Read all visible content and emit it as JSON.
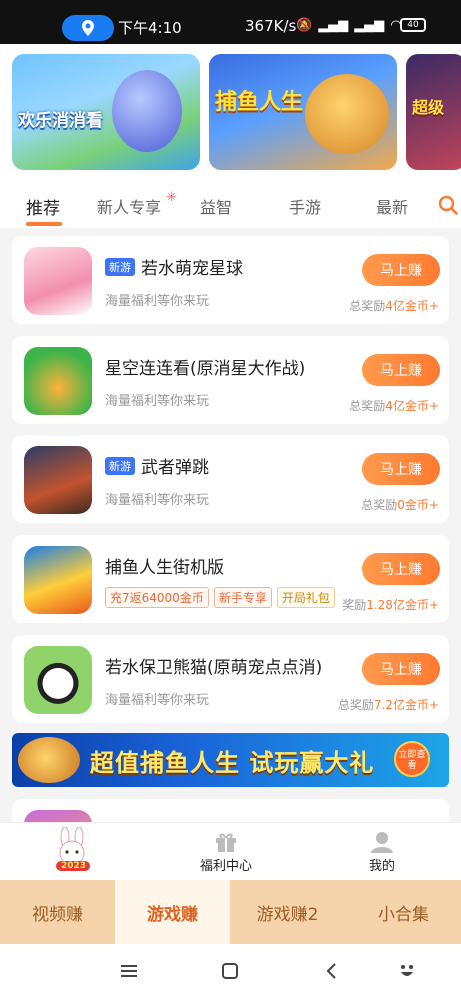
{
  "status_bar": {
    "time": "下午4:10",
    "speed": "367K/s",
    "battery": "40"
  },
  "banners": [
    {
      "title": "欢乐消消看"
    },
    {
      "title": "捕鱼人生"
    },
    {
      "title": "超级"
    }
  ],
  "tabs": [
    {
      "label": "推荐"
    },
    {
      "label": "新人专享"
    },
    {
      "label": "益智"
    },
    {
      "label": "手游"
    },
    {
      "label": "最新"
    }
  ],
  "games": [
    {
      "badge": "新游",
      "name": "若水萌宠星球",
      "subtitle": "海量福利等你来玩",
      "button": "马上赚",
      "reward_prefix": "总奖励",
      "reward_amount": "4亿金币+"
    },
    {
      "badge": "",
      "name": "星空连连看(原消星大作战)",
      "subtitle": "海量福利等你来玩",
      "button": "马上赚",
      "reward_prefix": "总奖励",
      "reward_amount": "4亿金币+"
    },
    {
      "badge": "新游",
      "name": "武者弹跳",
      "subtitle": "海量福利等你来玩",
      "button": "马上赚",
      "reward_prefix": "总奖励",
      "reward_amount": "0金币+"
    },
    {
      "badge": "",
      "name": "捕鱼人生街机版",
      "tags": [
        "充7返64000金币",
        "新手专享",
        "开局礼包"
      ],
      "button": "马上赚",
      "reward_prefix": "奖励",
      "reward_amount": "1.28亿金币+"
    },
    {
      "badge": "",
      "name": "若水保卫熊猫(原萌宠点点消)",
      "subtitle": "海量福利等你来玩",
      "button": "马上赚",
      "reward_prefix": "总奖励",
      "reward_amount": "7.2亿金币+"
    }
  ],
  "ad_banner": {
    "text": "超值捕鱼人生 试玩赢大礼",
    "button": "立即查看"
  },
  "subnav": {
    "welfare": "福利中心",
    "mine": "我的",
    "badge_year": "2023"
  },
  "main_tabs": [
    {
      "label": "视频赚"
    },
    {
      "label": "游戏赚"
    },
    {
      "label": "游戏赚2"
    },
    {
      "label": "小合集"
    }
  ],
  "colors": {
    "accent": "#ff7a30",
    "new_badge": "#3d74f5",
    "main_tab_bg": "#f5d4ab"
  }
}
